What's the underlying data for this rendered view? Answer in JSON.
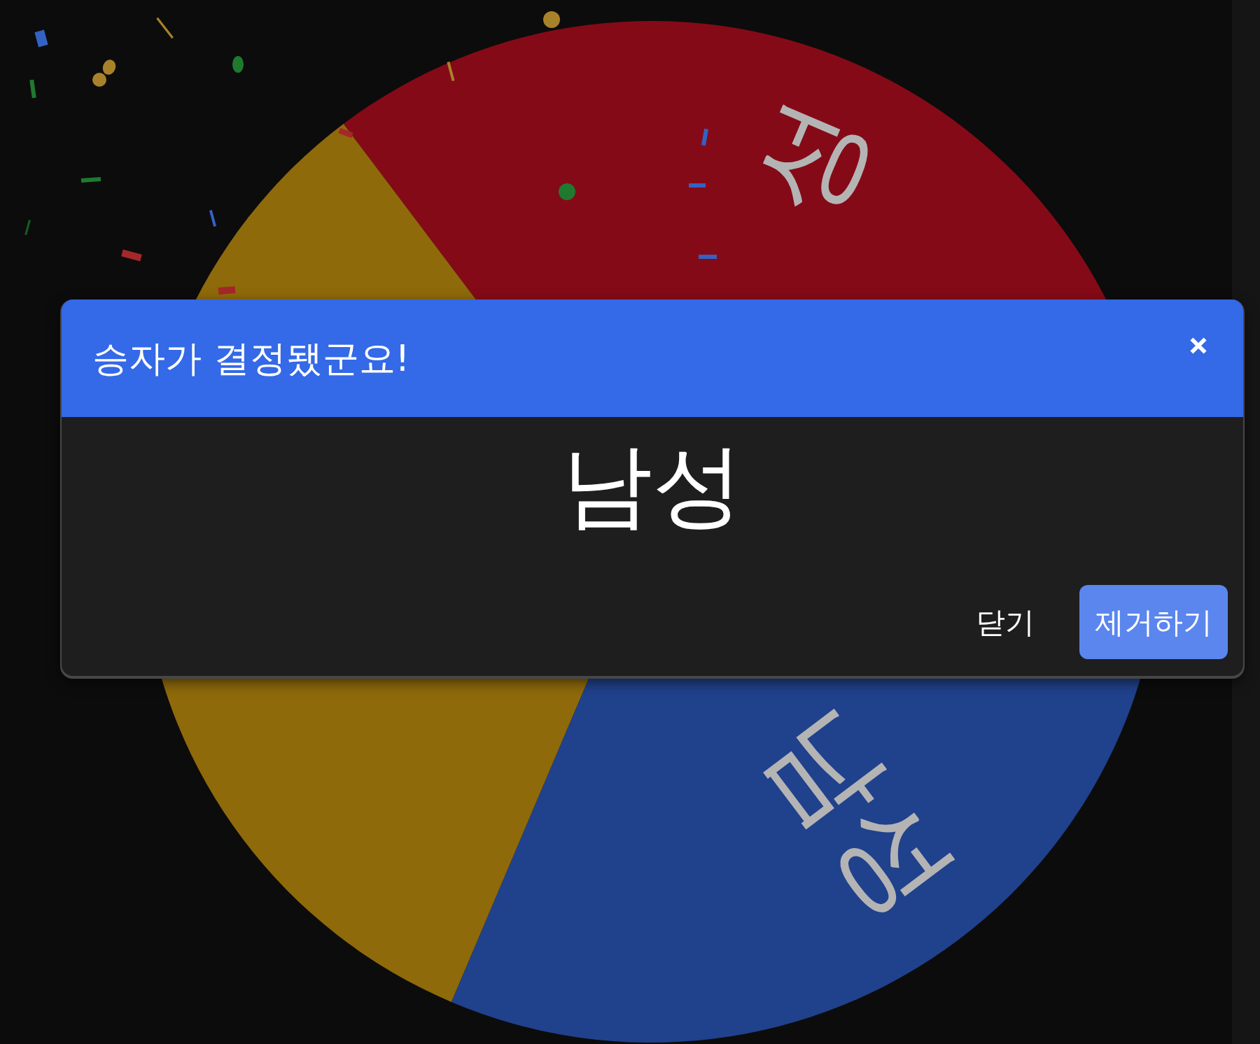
{
  "wheel": {
    "segments": [
      {
        "label": "성",
        "color": "#850a17"
      },
      {
        "label": "남성",
        "color": "#20418c"
      },
      {
        "color": "#8f6a0b"
      }
    ]
  },
  "dialog": {
    "title": "승자가 결정됐군요!",
    "winner": "남성",
    "buttons": [
      {
        "label": "닫기",
        "kind": "text"
      },
      {
        "label": "제거하기",
        "kind": "filled"
      }
    ]
  }
}
